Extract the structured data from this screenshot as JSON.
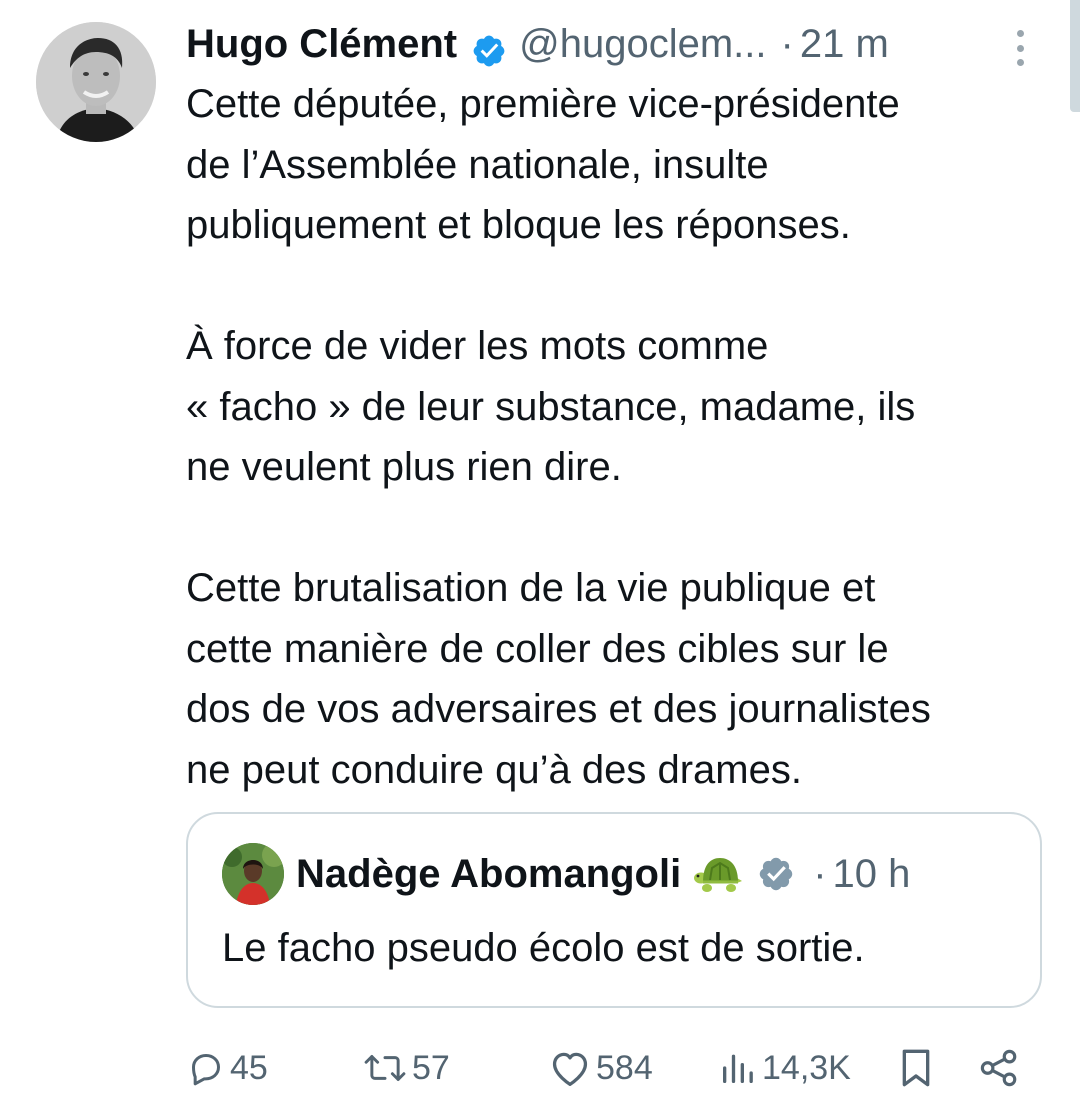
{
  "tweet": {
    "author_name": "Hugo Clément",
    "handle": "@hugoclem...",
    "separator": "·",
    "time": "21 m",
    "paragraphs": [
      [
        "Cette députée, première vice-présidente",
        "de l’Assemblée nationale, insulte",
        "publiquement et bloque les réponses."
      ],
      [
        "À force de vider les mots comme",
        "« facho » de leur substance, madame, ils",
        "ne veulent plus rien dire."
      ],
      [
        "Cette brutalisation de la vie publique et",
        "cette manière de coller des cibles sur le",
        "dos de vos adversaires et des journalistes",
        "ne peut conduire qu’à des drames."
      ]
    ]
  },
  "quote": {
    "author_name": "Nadège Abomangoli",
    "separator": "·",
    "time": "10 h",
    "text": "Le facho pseudo écolo est de sortie."
  },
  "actions": {
    "replies": "45",
    "reposts": "57",
    "likes": "584",
    "views": "14,3K"
  },
  "icons": {
    "verified": "verified-blue-badge-icon",
    "quote_verified": "verified-grey-badge-icon",
    "emoji": "turtle-emoji-icon",
    "more": "more-vertical-icon",
    "reply": "reply-icon",
    "repost": "repost-icon",
    "like": "heart-icon",
    "views": "views-icon",
    "bookmark": "bookmark-icon",
    "share": "share-icon"
  },
  "colors": {
    "verified_blue": "#1d9bf0",
    "verified_grey": "#829aab",
    "secondary_text": "#536471",
    "primary_text": "#0f1419",
    "border": "#cfd9de"
  }
}
